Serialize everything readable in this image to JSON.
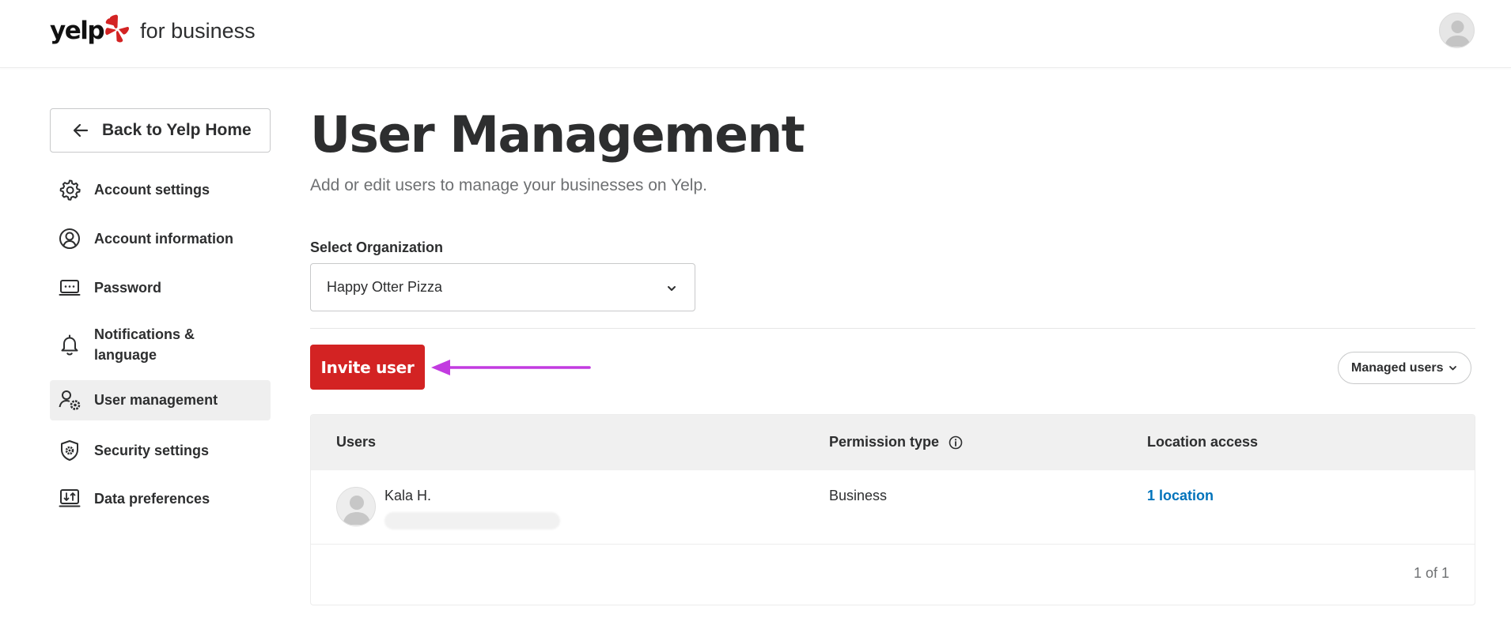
{
  "header": {
    "logo_word": "yelp",
    "logo_sub": "for business",
    "brand_color": "#d32323"
  },
  "sidebar": {
    "back_label": "Back to Yelp Home",
    "items": [
      {
        "label": "Account settings",
        "icon": "gear-icon",
        "active": false
      },
      {
        "label": "Account information",
        "icon": "user-circle-icon",
        "active": false
      },
      {
        "label": "Password",
        "icon": "password-icon",
        "active": false
      },
      {
        "label": "Notifications & language",
        "icon": "bell-icon",
        "active": false
      },
      {
        "label": "User management",
        "icon": "user-gear-icon",
        "active": true
      },
      {
        "label": "Security settings",
        "icon": "shield-icon",
        "active": false
      },
      {
        "label": "Data preferences",
        "icon": "data-icon",
        "active": false
      }
    ]
  },
  "main": {
    "title": "User Management",
    "subtitle": "Add or edit users to manage your businesses on Yelp.",
    "org": {
      "label": "Select Organization",
      "value": "Happy Otter Pizza"
    },
    "invite_label": "Invite user",
    "filter_label": "Managed users",
    "annotation_color": "#c23be0"
  },
  "table": {
    "columns": [
      "Users",
      "Permission type",
      "Location access"
    ],
    "rows": [
      {
        "name": "Kala H.",
        "permission": "Business",
        "location": "1 location"
      }
    ],
    "pager": "1 of 1"
  }
}
